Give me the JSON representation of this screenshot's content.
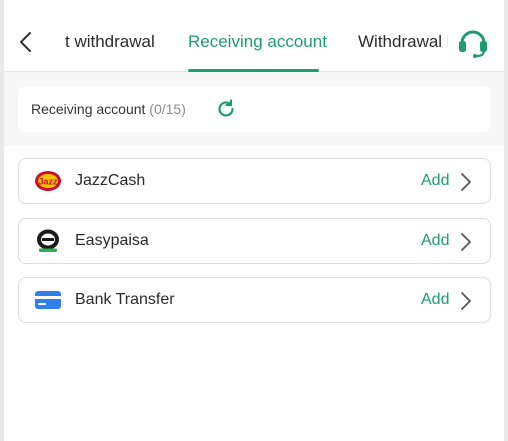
{
  "header": {
    "tabs": [
      {
        "label": "t withdrawal",
        "active": false
      },
      {
        "label": "Receiving account",
        "active": true
      },
      {
        "label": "Withdrawal l",
        "active": false
      }
    ],
    "back_icon": "chevron-left-icon",
    "support_icon": "headset-icon"
  },
  "summary": {
    "label": "Receiving account",
    "count": "(0/15)",
    "refresh_icon": "refresh-icon"
  },
  "accounts": [
    {
      "name": "JazzCash",
      "action": "Add",
      "icon": "jazzcash-logo"
    },
    {
      "name": "Easypaisa",
      "action": "Add",
      "icon": "easypaisa-logo"
    },
    {
      "name": "Bank Transfer",
      "action": "Add",
      "icon": "bank-card-icon"
    }
  ],
  "colors": {
    "accent": "#1f9b72",
    "text": "#2b2b2b",
    "muted": "#8a8a8a",
    "border": "#dcdcdc"
  }
}
